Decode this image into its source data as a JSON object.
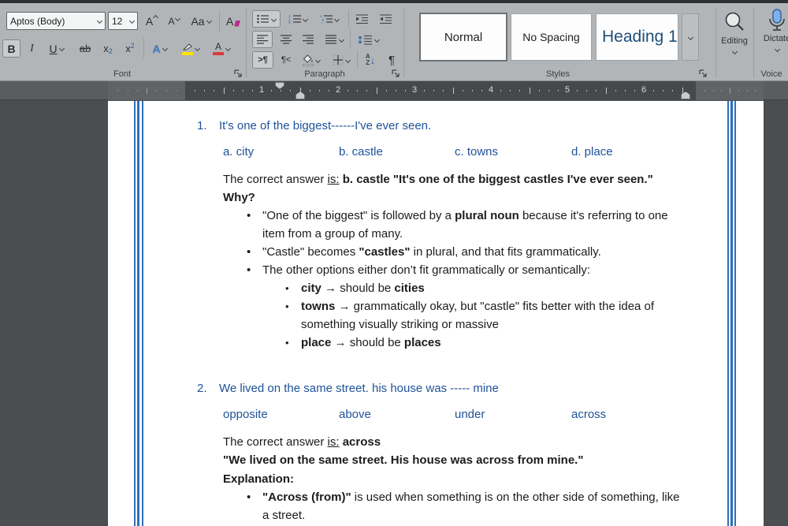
{
  "ribbon": {
    "font_group": {
      "label": "Font",
      "font_name": "Aptos (Body)",
      "font_size": "12",
      "grow_font": "A",
      "shrink_font": "A",
      "change_case": "Aa",
      "clear_formatting": "A",
      "bold": "B",
      "italic": "I",
      "underline": "U",
      "strikethrough": "ab",
      "subscript_base": "x",
      "subscript_mark": "2",
      "superscript_base": "x",
      "superscript_mark": "2",
      "text_effects": "A",
      "font_color": "A"
    },
    "paragraph_group": {
      "label": "Paragraph",
      "ltr_mark": ">¶",
      "rtl_mark": "¶<",
      "sort_a": "A",
      "sort_z": "Z",
      "sort_arrow": "↓",
      "pilcrow": "¶"
    },
    "styles_group": {
      "label": "Styles",
      "styles": [
        {
          "name": "Normal"
        },
        {
          "name": "No Spacing"
        },
        {
          "name": "Heading 1"
        }
      ]
    },
    "editing_group": {
      "label": "Editing"
    },
    "voice_group": {
      "label": "Voice",
      "dictate": "Dictate"
    }
  },
  "ruler": {
    "numbers": [
      "1",
      "2",
      "3",
      "4",
      "5",
      "6"
    ]
  },
  "colors": {
    "accent_blue": "#1f5299",
    "page_border_blue": "#2f6fb8",
    "highlight_yellow": "#ffe400",
    "font_color_red": "#d83b3b",
    "text_effects_blue": "#4a7ebb",
    "mic_blue": "#7fb1e8"
  },
  "doc": {
    "q1": {
      "number": "1.",
      "text": "It's one of the biggest------I've ever seen.",
      "options": [
        "a. city",
        "b. castle",
        "c. towns",
        "d. place"
      ],
      "answer": [
        {
          "t": "The correct answer "
        },
        {
          "t": "is:",
          "u": true
        },
        {
          "t": " "
        },
        {
          "t": "b. castle",
          "b": true
        },
        {
          "t": "  \"It's one of the biggest castles I've ever seen.\"",
          "b": true
        }
      ],
      "why": [
        {
          "t": "Why?",
          "b": true
        }
      ],
      "bullets": [
        [
          {
            "t": "\"One of the biggest\" is followed by a "
          },
          {
            "t": "plural noun",
            "b": true
          },
          {
            "t": " because it's referring to one item from a group of many."
          }
        ],
        [
          {
            "t": "\"Castle\" becomes "
          },
          {
            "t": "\"castles\"",
            "b": true
          },
          {
            "t": " in plural, and that fits grammatically."
          }
        ],
        [
          {
            "t": "The other options either don’t fit grammatically or semantically:"
          }
        ]
      ],
      "sub_bullets": [
        [
          {
            "t": "city",
            "b": true
          },
          {
            "t": " → should be "
          },
          {
            "t": "cities",
            "b": true
          }
        ],
        [
          {
            "t": "towns",
            "b": true
          },
          {
            "t": " → grammatically okay, but \"castle\" fits better with the idea of something visually striking or massive"
          }
        ],
        [
          {
            "t": "place",
            "b": true
          },
          {
            "t": " → should be "
          },
          {
            "t": "places",
            "b": true
          }
        ]
      ]
    },
    "q2": {
      "number": "2.",
      "text": "We lived on the same street. his house was ----- mine",
      "options": [
        "opposite",
        "above",
        "under",
        "across"
      ],
      "answer": [
        {
          "t": "The correct answer "
        },
        {
          "t": "is:",
          "u": true
        },
        {
          "t": " "
        },
        {
          "t": "across",
          "b": true
        }
      ],
      "quote": [
        {
          "t": "\"We lived on the same street. His house was across from mine.\"",
          "b": true
        }
      ],
      "explanation": [
        {
          "t": "Explanation:",
          "b": true
        }
      ],
      "bullets": [
        [
          {
            "t": "\"Across (from)\"",
            "b": true
          },
          {
            "t": " is used when something is on the other side of something, like a street."
          }
        ]
      ]
    }
  }
}
